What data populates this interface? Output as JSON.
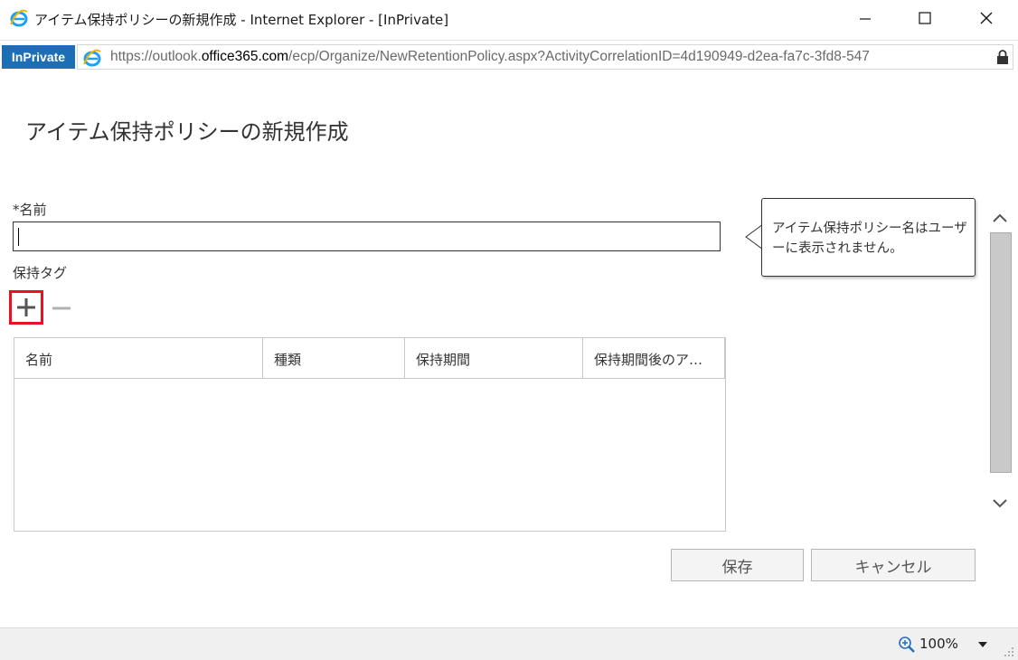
{
  "window": {
    "title": "アイテム保持ポリシーの新規作成 - Internet Explorer - [InPrivate]"
  },
  "address": {
    "inprivate_label": "InPrivate",
    "url_prefix": "https://outlook.",
    "url_domain": "office365.com",
    "url_rest": "/ecp/Organize/NewRetentionPolicy.aspx?ActivityCorrelationID=4d190949-d2ea-fa7c-3fd8-547"
  },
  "page": {
    "title": "アイテム保持ポリシーの新規作成"
  },
  "form": {
    "name_label": "*名前",
    "name_value": "",
    "retention_tag_label": "保持タグ",
    "table_columns": [
      "名前",
      "種類",
      "保持期間",
      "保持期間後のア…"
    ],
    "table_rows": []
  },
  "tooltip": {
    "text": "アイテム保持ポリシー名はユーザーに表示されません。"
  },
  "buttons": {
    "save": "保存",
    "cancel": "キャンセル"
  },
  "status": {
    "zoom": "100%"
  },
  "colors": {
    "inprivate_bg": "#1c6fb5",
    "highlight": "#e81123"
  },
  "icons": [
    "ie-logo-icon",
    "minimize-icon",
    "maximize-icon",
    "close-icon",
    "lock-icon",
    "add-icon",
    "remove-icon",
    "chevron-up-icon",
    "chevron-down-icon",
    "zoom-icon",
    "dropdown-icon"
  ]
}
